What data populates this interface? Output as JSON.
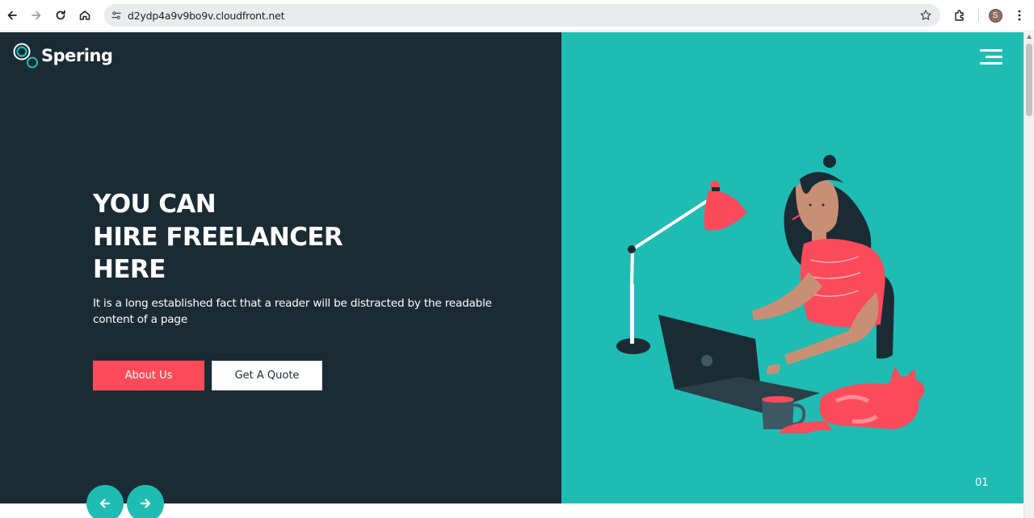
{
  "browser": {
    "url": "d2ydp4a9v9bo9v.cloudfront.net",
    "profile_initial": "S"
  },
  "site": {
    "logo_text": "Spering"
  },
  "hero": {
    "title_lines": [
      "YOU CAN",
      "HIRE FREELANCER",
      "HERE"
    ],
    "subtitle": "It is a long established fact that a reader will be distracted by the readable content of a page",
    "about_label": "About Us",
    "quote_label": "Get A Quote"
  },
  "slider": {
    "current": "01",
    "prev_icon": "arrow-left-icon",
    "next_icon": "arrow-right-icon"
  },
  "colors": {
    "left_bg": "#1b2b34",
    "right_bg": "#1fbcb4",
    "accent_red": "#fb4b5b",
    "white": "#ffffff"
  }
}
